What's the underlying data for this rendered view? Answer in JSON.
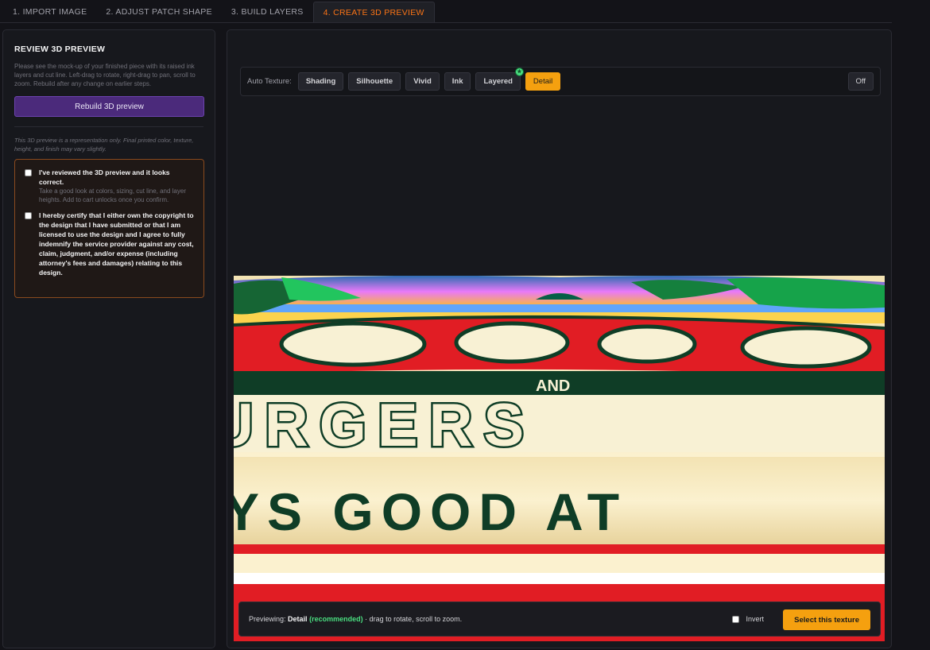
{
  "tabs": [
    {
      "label": "1. IMPORT IMAGE"
    },
    {
      "label": "2. ADJUST PATCH SHAPE"
    },
    {
      "label": "3. BUILD LAYERS"
    },
    {
      "label": "4. CREATE 3D PREVIEW"
    }
  ],
  "left_panel": {
    "title": "REVIEW 3D PREVIEW",
    "description": "Please see the mock-up of your finished piece with its raised ink layers and cut line. Left-drag to rotate, right-drag to pan, scroll to zoom. Rebuild after any change on earlier steps.",
    "rebuild_label": "Rebuild 3D preview",
    "disclaimer": "This 3D preview is a representation only. Final printed color, texture, height, and finish may vary slightly.",
    "checks": [
      {
        "label": "I've reviewed the 3D preview and it looks correct.",
        "sub": "Take a good look at colors, sizing, cut line, and layer heights. Add to cart unlocks once you confirm."
      },
      {
        "label": "I hereby certify that I either own the copyright to the design that I have submitted or that I am licensed to use the design and I agree to fully indemnify the service provider against any cost, claim, judgment, and/or expense (including attorney's fees and damages) relating to this design."
      }
    ]
  },
  "texture_bar": {
    "label": "Auto Texture:",
    "buttons": [
      "Shading",
      "Silhouette",
      "Vivid",
      "Ink",
      "Layered",
      "Detail"
    ],
    "selected": "Detail",
    "badge_icon": "star-icon",
    "off_label": "Off"
  },
  "preview_text": {
    "line1": "AND",
    "line2": "URGERS",
    "line3": "YS GOOD AT"
  },
  "status": {
    "prefix": "Previewing:",
    "texture": "Detail",
    "recommended": "(recommended)",
    "suffix": "· drag to rotate, scroll to zoom.",
    "invert_label": "Invert",
    "select_label": "Select this texture"
  },
  "colors": {
    "accent": "#f97316",
    "button_active": "#f5a00f",
    "rebuild": "#4b2a7b",
    "recommended": "#4ade80"
  }
}
